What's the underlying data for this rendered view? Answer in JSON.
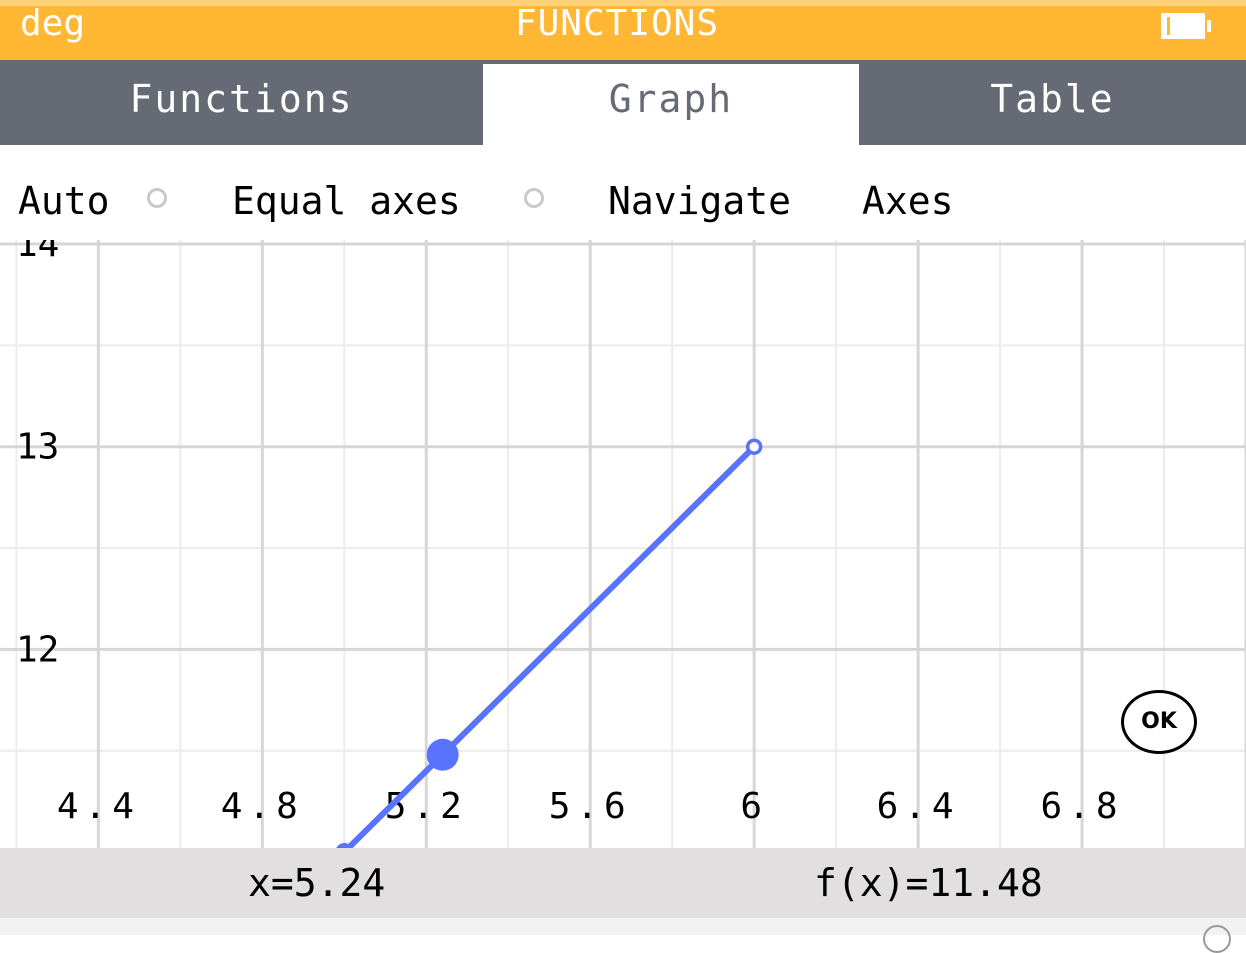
{
  "header": {
    "angle_mode": "deg",
    "title": "FUNCTIONS",
    "color": "#ffb734"
  },
  "tabs": [
    {
      "label": "Functions",
      "active": false
    },
    {
      "label": "Graph",
      "active": true
    },
    {
      "label": "Table",
      "active": false
    }
  ],
  "options": {
    "auto_label": "Auto",
    "auto_checked": false,
    "equal_axes_label": "Equal axes",
    "equal_axes_checked": false,
    "navigate_label": "Navigate",
    "axes_label": "Axes"
  },
  "chart_data": {
    "type": "line",
    "x_ticks": [
      "4.4",
      "4.8",
      "5.2",
      "5.6",
      "6",
      "6.4",
      "6.8"
    ],
    "x_tick_values": [
      4.4,
      4.8,
      5.2,
      5.6,
      6,
      6.4,
      6.8
    ],
    "y_ticks": [
      "14",
      "13",
      "12"
    ],
    "y_tick_values": [
      14,
      13,
      12
    ],
    "xlim": [
      4.16,
      7.2
    ],
    "ylim": [
      11.02,
      14.02
    ],
    "grid": true,
    "series": [
      {
        "color": "#5a73ff",
        "x": [
          5.0,
          6.0
        ],
        "y": [
          11.0,
          13.0
        ],
        "start_closed": true,
        "end_open": true
      }
    ],
    "cursor": {
      "x": 5.24,
      "y": 11.48
    }
  },
  "status": {
    "x_readout": "x=5.24",
    "fx_readout": "f(x)=11.48"
  },
  "ok_button": {
    "label": "OK"
  }
}
